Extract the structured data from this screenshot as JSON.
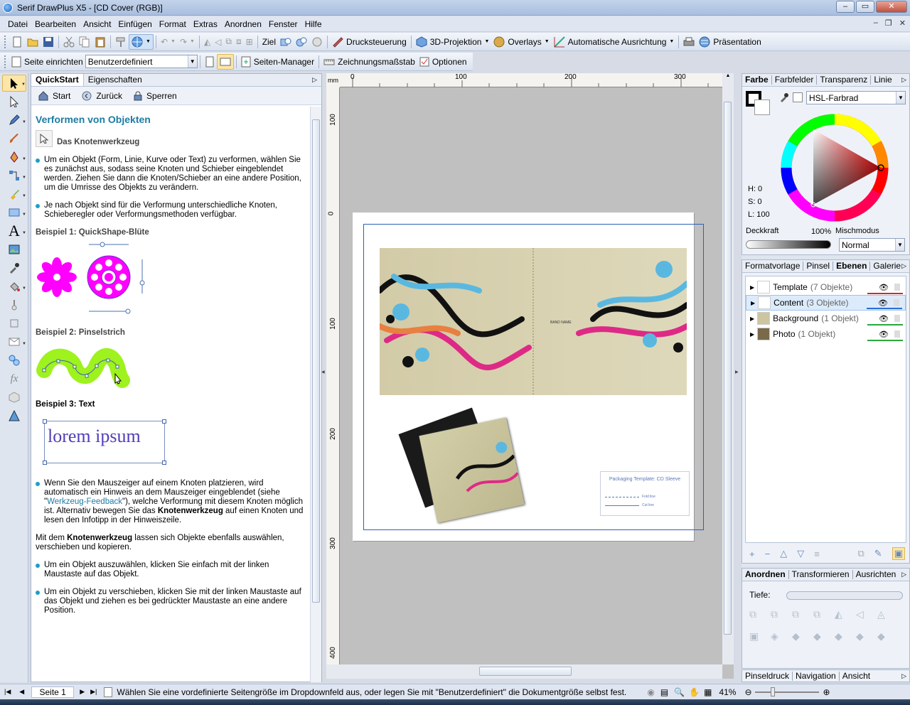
{
  "window": {
    "title": "Serif DrawPlus X5 - [CD Cover (RGB)]",
    "min": "–",
    "max": "▭",
    "close": "✕",
    "mdi_min": "–",
    "mdi_restore": "❐",
    "mdi_close": "✕"
  },
  "menu": [
    "Datei",
    "Bearbeiten",
    "Ansicht",
    "Einfügen",
    "Format",
    "Extras",
    "Anordnen",
    "Fenster",
    "Hilfe"
  ],
  "toolbar1": {
    "ziel": "Ziel",
    "drucksteuerung": "Drucksteuerung",
    "projektion": "3D-Projektion",
    "overlays": "Overlays",
    "ausrichtung": "Automatische Ausrichtung",
    "praesentation": "Präsentation"
  },
  "toolbar2": {
    "seite_einrichten": "Seite einrichten",
    "page_size": "Benutzerdefiniert",
    "seiten_manager": "Seiten-Manager",
    "zeichnungsmassstab": "Zeichnungsmaßstab",
    "optionen": "Optionen"
  },
  "left_panel": {
    "tabs": [
      "QuickStart",
      "Eigenschaften"
    ],
    "nav": {
      "start": "Start",
      "back": "Zurück",
      "lock": "Sperren"
    },
    "heading": "Verformen von Objekten",
    "subheading": "Das Knotenwerkzeug",
    "bullet1": "Um ein Objekt (Form, Linie, Kurve oder Text) zu verformen, wählen Sie es zunächst aus, sodass seine Knoten und Schieber eingeblendet werden. Ziehen Sie dann die Knoten/Schieber an eine andere Position, um die Umrisse des Objekts zu verändern.",
    "bullet2": "Je nach Objekt sind für die Verformung unterschiedliche Knoten, Schieberegler oder Verformungsmethoden verfügbar.",
    "example1": "Beispiel 1: QuickShape-Blüte",
    "example2": "Beispiel 2: Pinselstrich",
    "example3": "Beispiel 3: Text",
    "lorem": "lorem ipsum",
    "bullet3a": "Wenn Sie den Mauszeiger auf einem Knoten platzieren, wird automatisch ein Hinweis an dem Mauszeiger eingeblendet (siehe \"",
    "bullet3link": "Werkzeug-Feedback",
    "bullet3b": "\"), welche Verformung mit diesem Knoten möglich ist. Alternativ bewegen Sie das ",
    "bullet3bold": "Knotenwerkzeug",
    "bullet3c": " auf einen Knoten und lesen den Infotipp in der Hinweiszeile.",
    "para_a": "Mit dem ",
    "para_bold": "Knotenwerkzeug",
    "para_b": " lassen sich Objekte ebenfalls auswählen, verschieben und kopieren.",
    "bullet4": "Um ein Objekt auszuwählen, klicken Sie einfach mit der linken Maustaste auf das Objekt.",
    "bullet5": "Um ein Objekt zu verschieben, klicken Sie mit der linken Maustaste auf das Objekt und ziehen es bei gedrückter Maustaste an eine andere Position."
  },
  "canvas": {
    "unit": "mm",
    "hticks": [
      "0",
      "100",
      "200",
      "300"
    ],
    "vticks": [
      "100",
      "0",
      "100",
      "200",
      "300",
      "400"
    ],
    "band_name": "BAND NAME",
    "template_title": "Packaging Template: CD Sleeve",
    "fold_line": "Fold line",
    "cut_line": "Cut line"
  },
  "color_panel": {
    "tabs": [
      "Farbe",
      "Farbfelder",
      "Transparenz",
      "Linie"
    ],
    "mode": "HSL-Farbrad",
    "h": "H: 0",
    "s": "S: 0",
    "l": "L: 100",
    "opacity_label": "Deckkraft",
    "opacity_value": "100%",
    "blend_label": "Mischmodus",
    "blend_value": "Normal"
  },
  "layers_panel": {
    "tabs": [
      "Formatvorlage",
      "Pinsel",
      "Ebenen",
      "Galerie"
    ],
    "layers": [
      {
        "name": "Template",
        "count": "(7 Objekte)",
        "color": "#d42828"
      },
      {
        "name": "Content",
        "count": "(3 Objekte)",
        "color": "#2a6fd1"
      },
      {
        "name": "Background",
        "count": "(1 Objekt)",
        "color": "#2aa83a"
      },
      {
        "name": "Photo",
        "count": "(1 Objekt)",
        "color": "#2aa83a"
      }
    ]
  },
  "arrange_panel": {
    "tabs": [
      "Anordnen",
      "Transformieren",
      "Ausrichten"
    ],
    "depth": "Tiefe:"
  },
  "bottom_tabs": [
    "Pinseldruck",
    "Navigation",
    "Ansicht"
  ],
  "status": {
    "page": "Seite 1",
    "hint": "Wählen Sie eine vordefinierte Seitengröße im Dropdownfeld aus, oder legen Sie mit \"Benutzerdefiniert\" die Dokumentgröße selbst fest.",
    "zoom": "41%"
  }
}
